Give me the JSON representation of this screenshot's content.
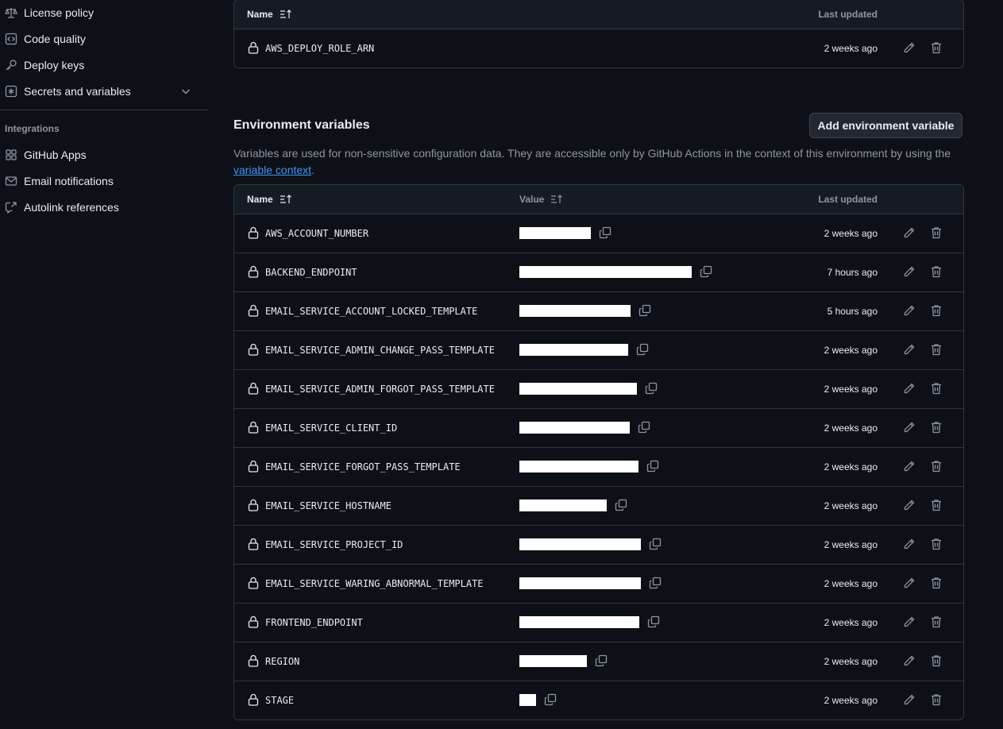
{
  "sidebar": {
    "items": [
      {
        "label": "License policy",
        "icon": "law-icon"
      },
      {
        "label": "Code quality",
        "icon": "code-square-icon"
      },
      {
        "label": "Deploy keys",
        "icon": "key-icon"
      },
      {
        "label": "Secrets and variables",
        "icon": "asterisk-icon"
      }
    ],
    "integrations_heading": "Integrations",
    "integrations": [
      {
        "label": "GitHub Apps",
        "icon": "apps-icon"
      },
      {
        "label": "Email notifications",
        "icon": "mail-icon"
      },
      {
        "label": "Autolink references",
        "icon": "cross-reference-icon"
      }
    ]
  },
  "secrets_table": {
    "headers": {
      "name": "Name",
      "last_updated": "Last updated"
    },
    "rows": [
      {
        "name": "AWS_DEPLOY_ROLE_ARN",
        "updated": "2 weeks ago"
      }
    ]
  },
  "env_vars": {
    "title": "Environment variables",
    "add_button": "Add environment variable",
    "description_prefix": "Variables are used for non-sensitive configuration data. They are accessible only by GitHub Actions in the context of this environment by using the ",
    "description_link": "variable context",
    "description_suffix": ".",
    "headers": {
      "name": "Name",
      "value": "Value",
      "last_updated": "Last updated"
    },
    "rows": [
      {
        "name": "AWS_ACCOUNT_NUMBER",
        "updated": "2 weeks ago"
      },
      {
        "name": "BACKEND_ENDPOINT",
        "updated": "7 hours ago"
      },
      {
        "name": "EMAIL_SERVICE_ACCOUNT_LOCKED_TEMPLATE",
        "updated": "5 hours ago"
      },
      {
        "name": "EMAIL_SERVICE_ADMIN_CHANGE_PASS_TEMPLATE",
        "updated": "2 weeks ago"
      },
      {
        "name": "EMAIL_SERVICE_ADMIN_FORGOT_PASS_TEMPLATE",
        "updated": "2 weeks ago"
      },
      {
        "name": "EMAIL_SERVICE_CLIENT_ID",
        "updated": "2 weeks ago"
      },
      {
        "name": "EMAIL_SERVICE_FORGOT_PASS_TEMPLATE",
        "updated": "2 weeks ago"
      },
      {
        "name": "EMAIL_SERVICE_HOSTNAME",
        "updated": "2 weeks ago"
      },
      {
        "name": "EMAIL_SERVICE_PROJECT_ID",
        "updated": "2 weeks ago"
      },
      {
        "name": "EMAIL_SERVICE_WARING_ABNORMAL_TEMPLATE",
        "updated": "2 weeks ago"
      },
      {
        "name": "FRONTEND_ENDPOINT",
        "updated": "2 weeks ago"
      },
      {
        "name": "REGION",
        "updated": "2 weeks ago"
      },
      {
        "name": "STAGE",
        "updated": "2 weeks ago"
      }
    ]
  },
  "colors": {
    "background": "#0d1117",
    "border": "#30363d",
    "header_bg": "#151b23",
    "text": "#e6edf3",
    "muted": "#8d96a0",
    "link": "#4493f8",
    "redaction": "#ffffff"
  }
}
